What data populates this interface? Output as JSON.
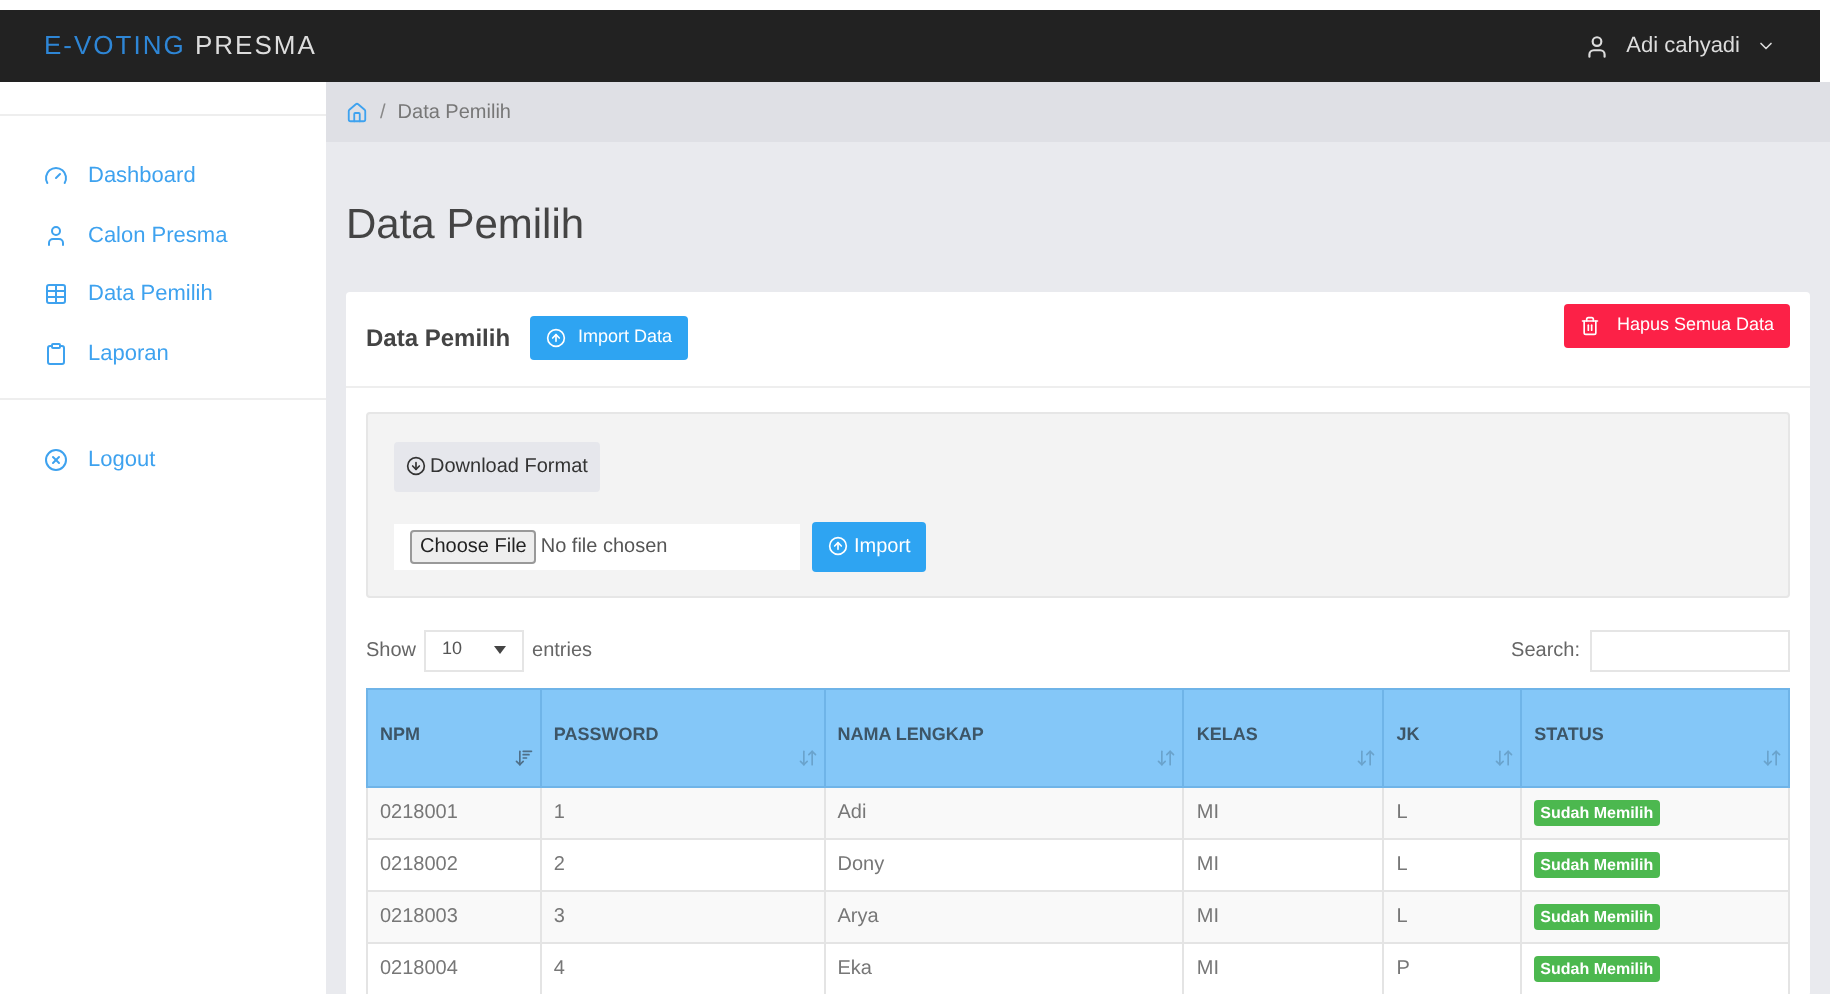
{
  "navbar": {
    "brand_accent": "E-VOTING",
    "brand": "PRESMA",
    "user": "Adi cahyadi"
  },
  "sidebar": {
    "items": [
      {
        "label": "Dashboard"
      },
      {
        "label": "Calon Presma"
      },
      {
        "label": "Data Pemilih"
      },
      {
        "label": "Laporan"
      }
    ],
    "logout": "Logout"
  },
  "breadcrumb_separator": "/",
  "breadcrumb": "Data Pemilih",
  "page_title": "Data Pemilih",
  "card": {
    "title": "Data Pemilih",
    "import_button": "Import Data",
    "delete_button": "Hapus Semua Data",
    "download_button": "Download Format",
    "file_button": "Choose File",
    "file_status": "No file chosen",
    "upload_button": "Import"
  },
  "table_controls": {
    "show": "Show",
    "page_size": "10",
    "entries": "entries",
    "search_label": "Search:"
  },
  "table": {
    "columns": [
      {
        "label": "NPM",
        "sorted": true
      },
      {
        "label": "PASSWORD",
        "sorted": false
      },
      {
        "label": "NAMA LENGKAP",
        "sorted": false
      },
      {
        "label": "KELAS",
        "sorted": false
      },
      {
        "label": "JK",
        "sorted": false
      },
      {
        "label": "STATUS",
        "sorted": false
      }
    ],
    "rows": [
      [
        "0218001",
        "1",
        "Adi",
        "MI",
        "L",
        "Sudah Memilih"
      ],
      [
        "0218002",
        "2",
        "Dony",
        "MI",
        "L",
        "Sudah Memilih"
      ],
      [
        "0218003",
        "3",
        "Arya",
        "MI",
        "L",
        "Sudah Memilih"
      ],
      [
        "0218004",
        "4",
        "Eka",
        "MI",
        "P",
        "Sudah Memilih"
      ]
    ]
  }
}
